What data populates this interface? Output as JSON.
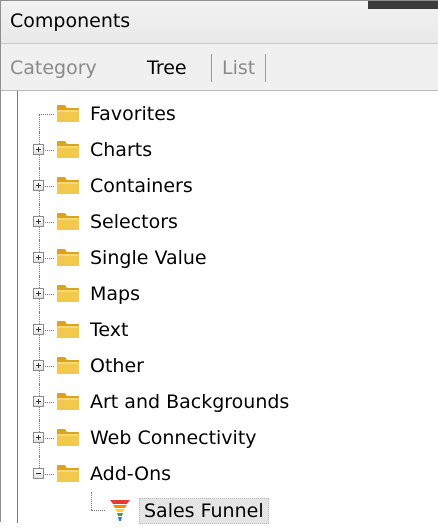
{
  "panel": {
    "title": "Components"
  },
  "tabs": [
    {
      "label": "Category",
      "active": false
    },
    {
      "label": "Tree",
      "active": true
    },
    {
      "label": "List",
      "active": false
    }
  ],
  "tree": {
    "items": [
      {
        "label": "Favorites",
        "expander": "none"
      },
      {
        "label": "Charts",
        "expander": "plus"
      },
      {
        "label": "Containers",
        "expander": "plus"
      },
      {
        "label": "Selectors",
        "expander": "plus"
      },
      {
        "label": "Single Value",
        "expander": "plus"
      },
      {
        "label": "Maps",
        "expander": "plus"
      },
      {
        "label": "Text",
        "expander": "plus"
      },
      {
        "label": "Other",
        "expander": "plus"
      },
      {
        "label": "Art and Backgrounds",
        "expander": "plus"
      },
      {
        "label": "Web Connectivity",
        "expander": "plus"
      },
      {
        "label": "Add-Ons",
        "expander": "minus"
      }
    ],
    "children": [
      {
        "label": "Sales Funnel",
        "icon": "funnel-icon"
      }
    ]
  },
  "colors": {
    "folder": "#f2c94c",
    "folder_dark": "#d9a520",
    "selection_bg": "#e5e5e5"
  }
}
